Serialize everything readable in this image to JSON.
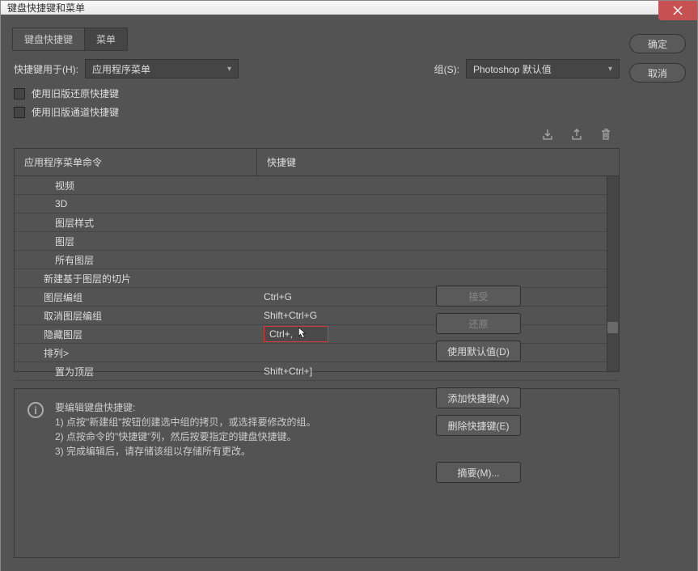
{
  "window": {
    "title": "键盘快捷键和菜单"
  },
  "tabs": {
    "shortcuts": "键盘快捷键",
    "menus": "菜单"
  },
  "controls": {
    "shortcutsFor_label": "快捷键用于(H):",
    "shortcutsFor_value": "应用程序菜单",
    "set_label": "组(S):",
    "set_value": "Photoshop 默认值",
    "useLegacyUndo": "使用旧版还原快捷键",
    "useLegacyChannel": "使用旧版通道快捷键"
  },
  "listHeader": {
    "col1": "应用程序菜单命令",
    "col2": "快捷键"
  },
  "rows": [
    {
      "label": "视频",
      "shortcut": "",
      "indent": 1
    },
    {
      "label": "3D",
      "shortcut": "",
      "indent": 1
    },
    {
      "label": "图层样式",
      "shortcut": "",
      "indent": 1
    },
    {
      "label": "图层",
      "shortcut": "",
      "indent": 1
    },
    {
      "label": "所有图层",
      "shortcut": "",
      "indent": 1
    },
    {
      "label": "新建基于图层的切片",
      "shortcut": "",
      "indent": 2
    },
    {
      "label": "图层编组",
      "shortcut": "Ctrl+G",
      "indent": 2
    },
    {
      "label": "取消图层编组",
      "shortcut": "Shift+Ctrl+G",
      "indent": 2
    },
    {
      "label": "隐藏图层",
      "shortcut": "Ctrl+,",
      "indent": 2,
      "editing": true
    },
    {
      "label": "排列>",
      "shortcut": "",
      "indent": 2
    },
    {
      "label": "置为顶层",
      "shortcut": "Shift+Ctrl+]",
      "indent": 1
    }
  ],
  "info": {
    "title": "要编辑键盘快捷键:",
    "line1": "1) 点按\"新建组\"按钮创建选中组的拷贝，或选择要修改的组。",
    "line2": "2) 点按命令的\"快捷键\"列，然后按要指定的键盘快捷键。",
    "line3": "3) 完成编辑后，请存储该组以存储所有更改。"
  },
  "buttons": {
    "ok": "确定",
    "cancel": "取消",
    "accept": "接受",
    "undo": "还原",
    "useDefault": "使用默认值(D)",
    "addShortcut": "添加快捷键(A)",
    "deleteShortcut": "删除快捷键(E)",
    "summarize": "摘要(M)..."
  }
}
